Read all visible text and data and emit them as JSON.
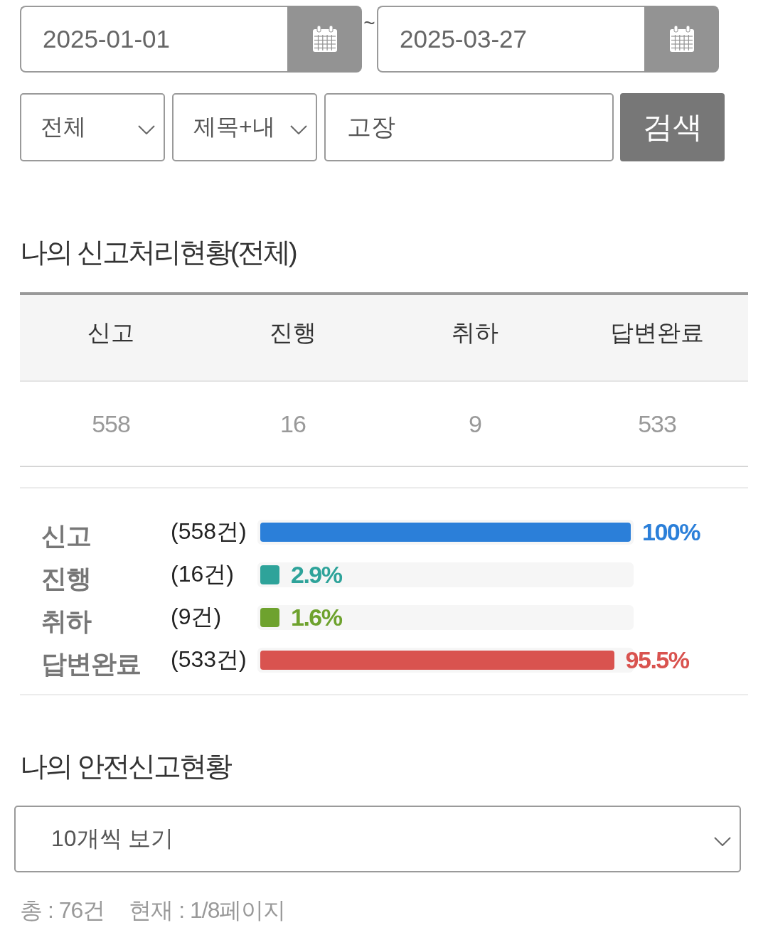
{
  "date_range": {
    "start": {
      "value": "2025-01-01"
    },
    "separator": "~",
    "end": {
      "value": "2025-03-27"
    }
  },
  "search": {
    "category": {
      "value": "전체"
    },
    "field": {
      "value": "제목+내"
    },
    "keyword": {
      "value": "고장"
    },
    "button": "검색"
  },
  "status_summary": {
    "title": "나의 신고처리현황(전체)",
    "columns": [
      "신고",
      "진행",
      "취하",
      "답변완료"
    ],
    "values": [
      "558",
      "16",
      "9",
      "533"
    ]
  },
  "ratio_bars": [
    {
      "label": "신고",
      "count": "(558건)",
      "level": 1,
      "percent": "100%",
      "color": "#2b7fd9"
    },
    {
      "label": "진행",
      "count": "(16건)",
      "level": 0.029,
      "percent": "2.9%",
      "color": "#2ea39a"
    },
    {
      "label": "취하",
      "count": "(9건)",
      "level": 0.016,
      "percent": "1.6%",
      "color": "#6ea22e"
    },
    {
      "label": "답변완료",
      "count": "(533건)",
      "level": 0.955,
      "percent": "95.5%",
      "color": "#d9534f"
    }
  ],
  "safety_reports": {
    "title": "나의 안전신고현황",
    "page_size": {
      "value": "10개씩 보기"
    },
    "total": "총 : 76건",
    "current": "현재 : 1/8페이지"
  }
}
